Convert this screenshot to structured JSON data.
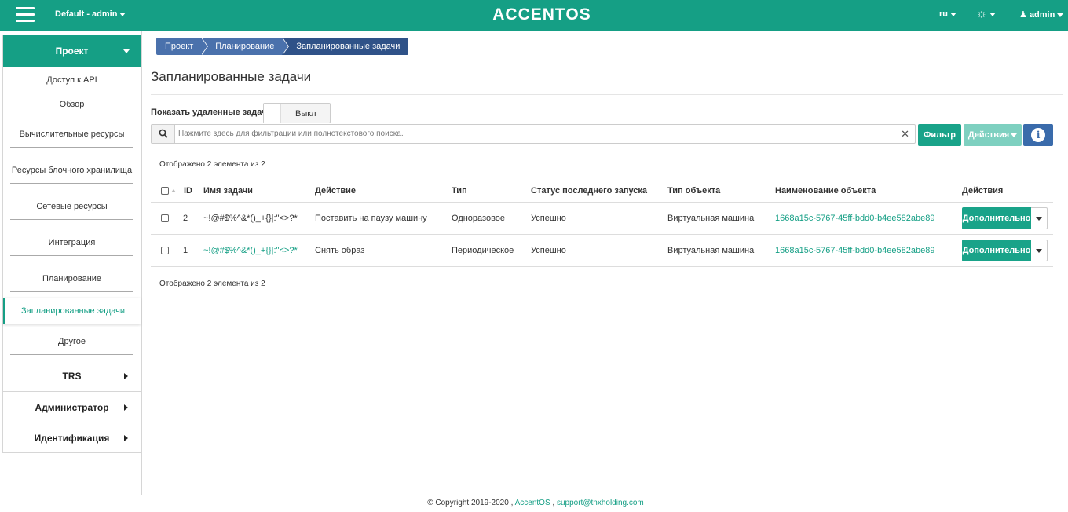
{
  "topbar": {
    "project": "Default - admin",
    "logo": "ACCENTOS",
    "lang": "ru",
    "user": "admin"
  },
  "sidebar": {
    "project_label": "Проект",
    "items": [
      {
        "label": "Доступ к API"
      },
      {
        "label": "Обзор"
      },
      {
        "label": "Вычислительные ресурсы"
      },
      {
        "label": "Ресурсы блочного хранилища"
      },
      {
        "label": "Сетевые ресурсы"
      },
      {
        "label": "Интеграция"
      },
      {
        "label": "Планирование"
      },
      {
        "label": "Запланированные задачи"
      },
      {
        "label": "Другое"
      }
    ],
    "groups": [
      {
        "label": "TRS"
      },
      {
        "label": "Администратор"
      },
      {
        "label": "Идентификация"
      }
    ]
  },
  "breadcrumb": [
    "Проект",
    "Планирование",
    "Запланированные задачи"
  ],
  "page_title": "Запланированные задачи",
  "show_deleted": {
    "label": "Показать удаленные задачи",
    "value": "Выкл"
  },
  "search": {
    "placeholder": "Нажмите здесь для фильтрации или полнотекстового поиска."
  },
  "buttons": {
    "filter": "Фильтр",
    "actions": "Действия"
  },
  "count_text": "Отображено 2 элемента из 2",
  "table": {
    "columns": [
      "ID",
      "Имя задачи",
      "Действие",
      "Тип",
      "Статус последнего запуска",
      "Тип объекта",
      "Наименование объекта",
      "Действия"
    ],
    "rows": [
      {
        "id": "2",
        "name": "~!@#$%^&*()_+{}|:\"<>?*",
        "action": "Поставить на паузу машину",
        "type": "Одноразовое",
        "status": "Успешно",
        "object_type": "Виртуальная машина",
        "object_name": "1668a15c-5767-45ff-bdd0-b4ee582abe89",
        "more": "Дополнительно"
      },
      {
        "id": "1",
        "name": "~!@#$%^&*()_+{}|:\"<>?*",
        "action": "Снять образ",
        "type": "Периодическое",
        "status": "Успешно",
        "object_type": "Виртуальная машина",
        "object_name": "1668a15c-5767-45ff-bdd0-b4ee582abe89",
        "more": "Дополнительно"
      }
    ]
  },
  "footer": {
    "copyright": "© Copyright 2019-2020 ,",
    "brand": "AccentOS",
    "sep": ",",
    "email": "support@tnxholding.com"
  },
  "colors": {
    "primary": "#159f85",
    "breadcrumb": "#4a71ac",
    "breadcrumb_active": "#2f5288",
    "info": "#3a6bab"
  }
}
